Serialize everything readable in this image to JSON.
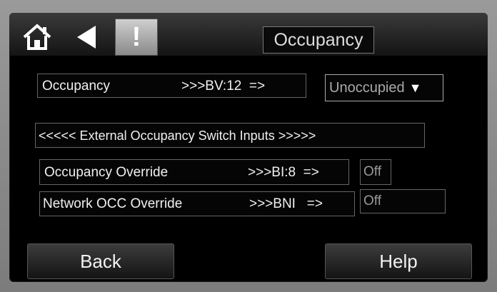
{
  "header": {
    "title": "Occupancy",
    "home_icon": "home-icon",
    "back_icon": "back-arrow-icon",
    "alert_symbol": "!"
  },
  "rows": {
    "occupancy": {
      "label": "Occupancy",
      "point": ">>>BV:12  =>",
      "value": "Unoccupied"
    },
    "section_title": "<<<<< External Occupancy Switch Inputs >>>>>",
    "override": {
      "label": "Occupancy Override",
      "point": ">>>BI:8  =>",
      "value": "Off"
    },
    "network": {
      "label": "Network OCC Override",
      "point": ">>>BNI   =>",
      "value": "Off"
    }
  },
  "footer": {
    "back_label": "Back",
    "help_label": "Help"
  }
}
